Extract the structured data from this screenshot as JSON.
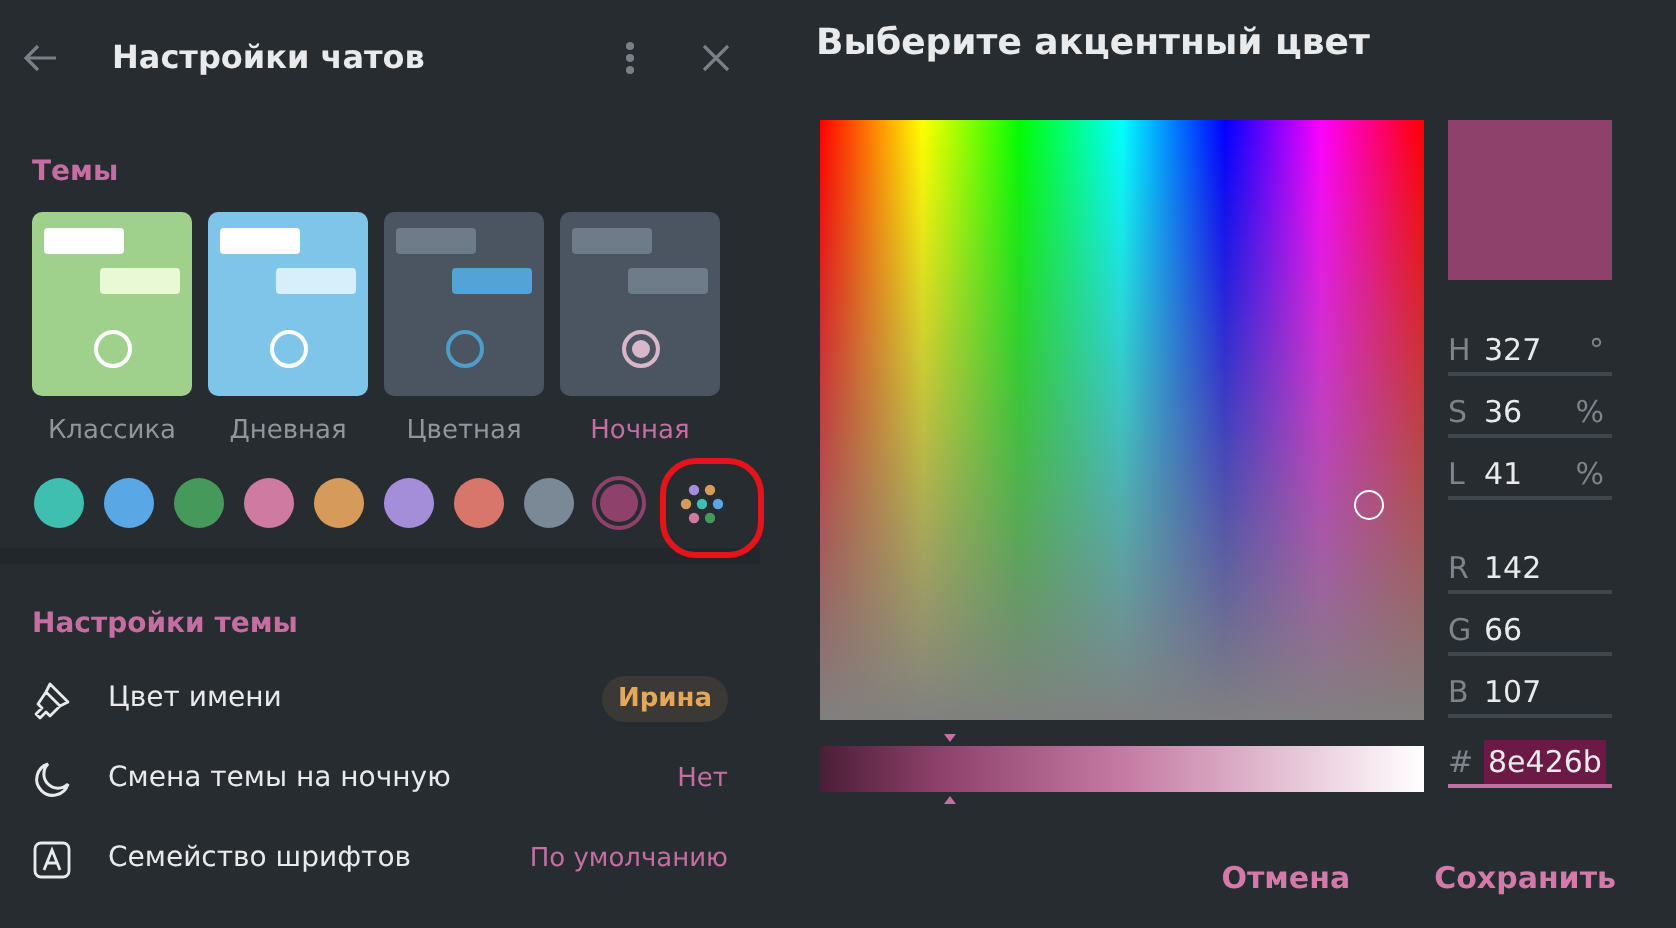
{
  "panel": {
    "title": "Настройки чатов"
  },
  "themes": {
    "heading": "Темы",
    "items": [
      {
        "label": "Классика",
        "selected": false,
        "color": "#9fd18c"
      },
      {
        "label": "Дневная",
        "selected": false,
        "color": "#7fc5ea"
      },
      {
        "label": "Цветная",
        "selected": false,
        "color": "#4a5561"
      },
      {
        "label": "Ночная",
        "selected": true,
        "color": "#4a5561"
      }
    ]
  },
  "accents": [
    {
      "kind": "swatch",
      "color": "#3fbfb0",
      "selected": false
    },
    {
      "kind": "swatch",
      "color": "#5aa7e6",
      "selected": false
    },
    {
      "kind": "swatch",
      "color": "#45995a",
      "selected": false
    },
    {
      "kind": "swatch",
      "color": "#cf7aa0",
      "selected": false
    },
    {
      "kind": "swatch",
      "color": "#d69a5b",
      "selected": false
    },
    {
      "kind": "swatch",
      "color": "#a58ed9",
      "selected": false
    },
    {
      "kind": "swatch",
      "color": "#d9766c",
      "selected": false
    },
    {
      "kind": "swatch",
      "color": "#7b8896",
      "selected": false
    },
    {
      "kind": "swatch",
      "color": "#8e426b",
      "selected": true
    },
    {
      "kind": "custom",
      "selected": false
    }
  ],
  "theme_settings": {
    "heading": "Настройки темы",
    "rows": [
      {
        "label": "Цвет имени",
        "value": "Ирина",
        "kind": "badge"
      },
      {
        "label": "Смена темы на ночную",
        "value": "Нет",
        "kind": "text"
      },
      {
        "label": "Семейство шрифтов",
        "value": "По умолчанию",
        "kind": "text"
      }
    ]
  },
  "picker": {
    "title": "Выберите акцентный цвет",
    "fields": [
      {
        "label": "H",
        "value": "327",
        "unit": "°"
      },
      {
        "label": "S",
        "value": "36",
        "unit": "%"
      },
      {
        "label": "L",
        "value": "41",
        "unit": "%"
      },
      {
        "label": "R",
        "value": "142"
      },
      {
        "label": "G",
        "value": "66"
      },
      {
        "label": "B",
        "value": "107"
      }
    ],
    "hex": {
      "label": "#",
      "value": "8e426b"
    },
    "lightness": {
      "level": 0.215
    },
    "buttons": [
      "Отмена",
      "Сохранить"
    ]
  }
}
